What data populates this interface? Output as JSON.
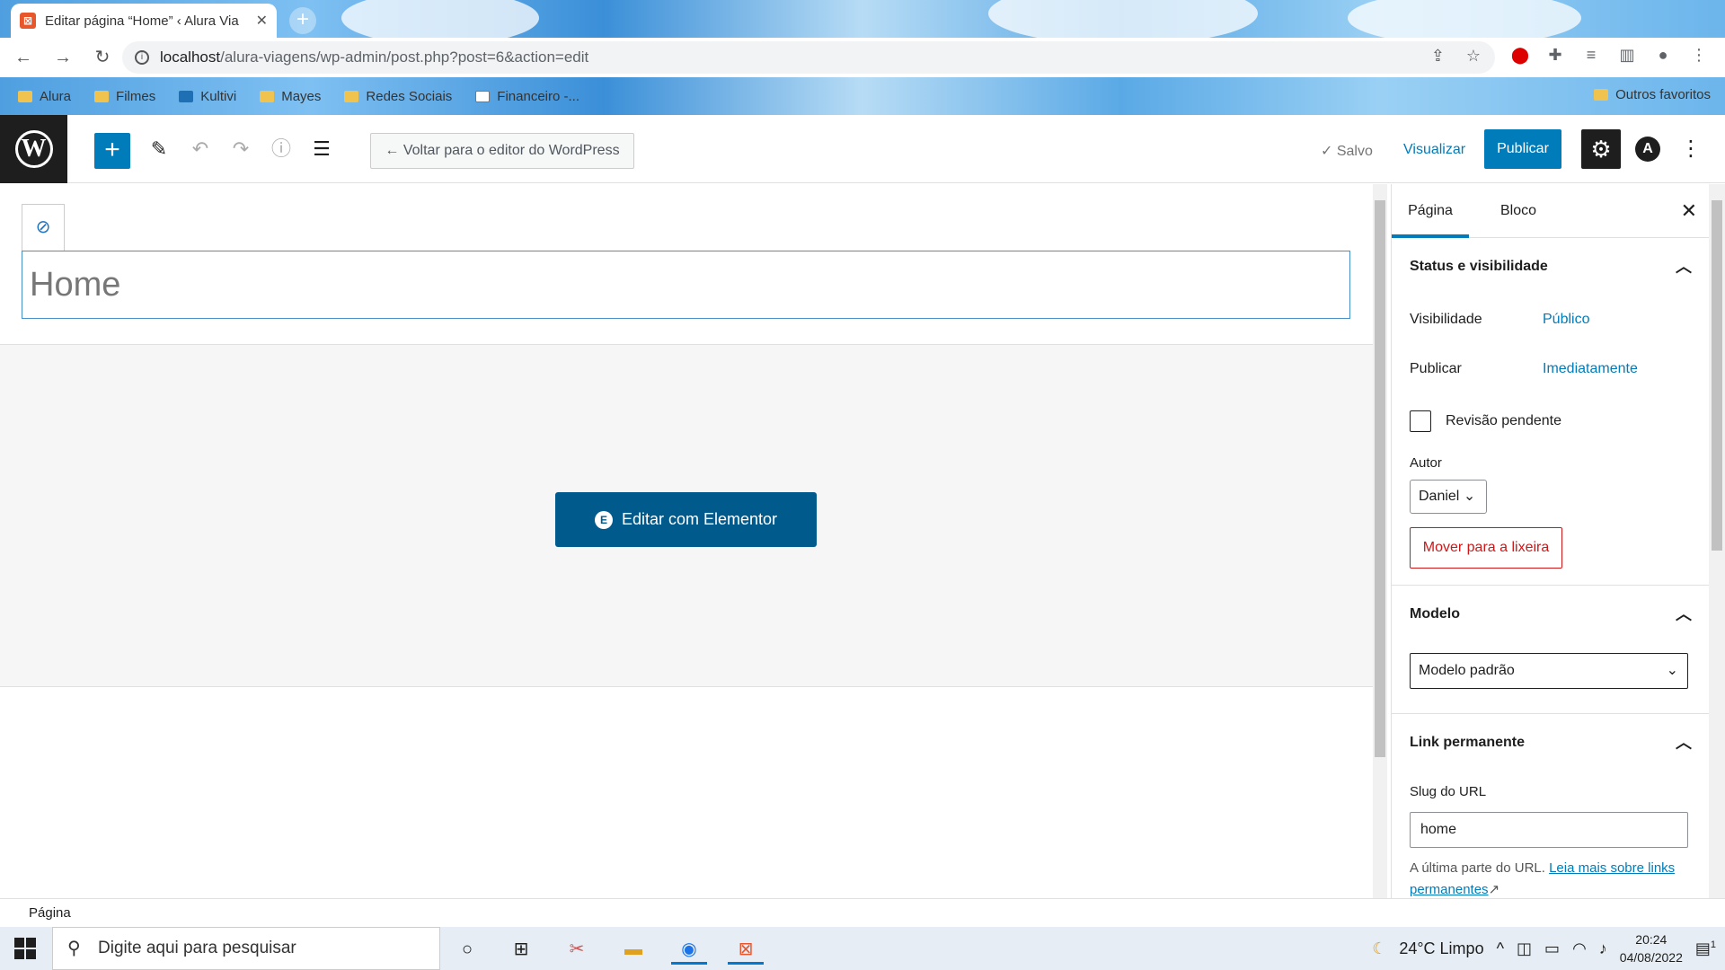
{
  "browser": {
    "tab_title": "Editar página “Home” ‹ Alura Via",
    "url_host": "localhost",
    "url_path": "/alura-viagens/wp-admin/post.php?post=6&action=edit",
    "bookmarks": [
      "Alura",
      "Filmes",
      "Kultivi",
      "Mayes",
      "Redes Sociais",
      "Financeiro -..."
    ],
    "other_bookmarks": "Outros favoritos"
  },
  "wp_header": {
    "back_label": "← Voltar para o editor do WordPress",
    "saved_label": "Salvo",
    "preview_label": "Visualizar",
    "publish_label": "Publicar"
  },
  "editor": {
    "title": "Home",
    "elementor_button": "Editar com Elementor"
  },
  "sidebar": {
    "tab_page": "Página",
    "tab_block": "Bloco",
    "status_heading": "Status e visibilidade",
    "visibility_label": "Visibilidade",
    "visibility_value": "Público",
    "publish_label": "Publicar",
    "publish_value": "Imediatamente",
    "pending_review": "Revisão pendente",
    "author_label": "Autor",
    "author_value": "Daniel",
    "trash_label": "Mover para a lixeira",
    "template_heading": "Modelo",
    "template_value": "Modelo padrão",
    "permalink_heading": "Link permanente",
    "slug_label": "Slug do URL",
    "slug_value": "home",
    "slug_help": "A última parte do URL.",
    "slug_help_link": "Leia mais sobre links permanentes"
  },
  "footer": {
    "breadcrumb": "Página"
  },
  "taskbar": {
    "search_placeholder": "Digite aqui para pesquisar",
    "weather": "24°C  Limpo",
    "time": "20:24",
    "date": "04/08/2022",
    "notifications": "1"
  }
}
